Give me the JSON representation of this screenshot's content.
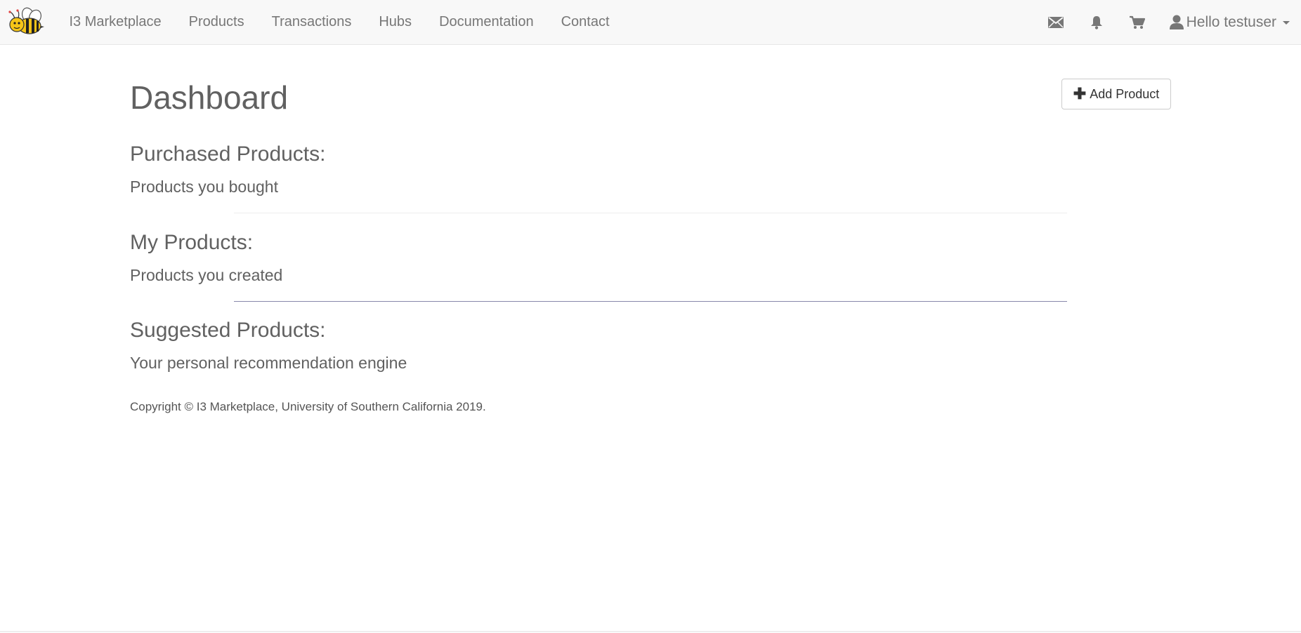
{
  "navbar": {
    "brand": "I3 Marketplace",
    "links": [
      "Products",
      "Transactions",
      "Hubs",
      "Documentation",
      "Contact"
    ],
    "icons": [
      "envelope-icon",
      "bell-icon",
      "cart-icon",
      "user-icon"
    ],
    "user_greeting": "Hello testuser"
  },
  "main": {
    "title": "Dashboard",
    "add_product_label": "Add Product",
    "sections": [
      {
        "heading": "Purchased Products:",
        "subtitle": "Products you bought"
      },
      {
        "heading": "My Products:",
        "subtitle": "Products you created"
      },
      {
        "heading": "Suggested Products:",
        "subtitle": "Your personal recommendation engine"
      }
    ]
  },
  "footer": {
    "copyright": "Copyright © I3 Marketplace, University of Southern California 2019."
  },
  "colors": {
    "navbar_bg": "#f8f8f8",
    "nav_text": "#777777",
    "heading_text": "#616161",
    "bee_yellow": "#f5c518"
  }
}
